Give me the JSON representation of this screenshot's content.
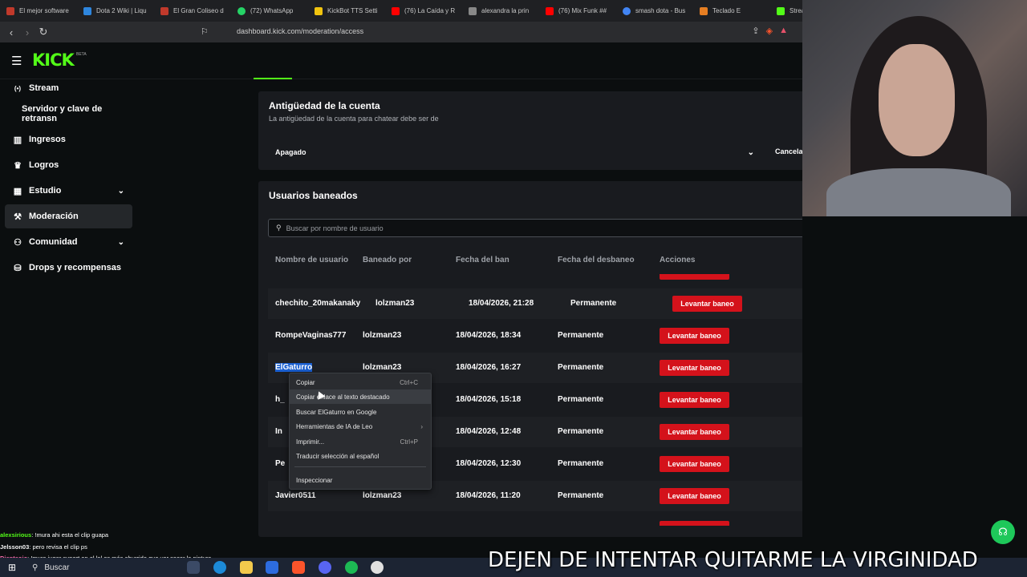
{
  "browser": {
    "tabs": [
      {
        "label": "El mejor software",
        "color": "#c0392b"
      },
      {
        "label": "Dota 2 Wiki | Liqu",
        "color": "#2e86de"
      },
      {
        "label": "El Gran Coliseo d",
        "color": "#c0392b"
      },
      {
        "label": "(72) WhatsApp",
        "color": "#25d366"
      },
      {
        "label": "KickBot TTS Setti",
        "color": "#f1c40f"
      },
      {
        "label": "(76) La Caída y R",
        "color": "#ff0000"
      },
      {
        "label": "alexandra la prin",
        "color": "#888888"
      },
      {
        "label": "(76) Mix Funk ##",
        "color": "#ff0000"
      },
      {
        "label": "smash dota - Bus",
        "color": "#4285f4"
      },
      {
        "label": "Teclado E",
        "color": "#e67e22"
      },
      {
        "label": "Stream",
        "color": "#53fc18"
      }
    ],
    "url": "dashboard.kick.com/moderation/access"
  },
  "header": {
    "logo": "KICK",
    "beta": "BETA"
  },
  "sidebar": {
    "items": [
      {
        "label": "Stream",
        "icon": "broadcast-icon",
        "glyph": "((•))"
      },
      {
        "label": "Servidor y clave de retransn",
        "icon": "",
        "glyph": ""
      },
      {
        "label": "Ingresos",
        "icon": "chart-icon",
        "glyph": "▥"
      },
      {
        "label": "Logros",
        "icon": "trophy-icon",
        "glyph": "🏆"
      },
      {
        "label": "Estudio",
        "icon": "grid-icon",
        "glyph": "▦"
      },
      {
        "label": "Moderación",
        "icon": "wrench-icon",
        "glyph": "🔧"
      },
      {
        "label": "Comunidad",
        "icon": "people-icon",
        "glyph": "👥"
      },
      {
        "label": "Drops y recompensas",
        "icon": "rewards-icon",
        "glyph": "⛁"
      }
    ]
  },
  "account_age": {
    "title": "Antigüedad de la cuenta",
    "subtitle": "La antigüedad de la cuenta para chatear debe ser de",
    "selected": "Apagado",
    "cancel": "Cancela"
  },
  "banned": {
    "title": "Usuarios baneados",
    "search_placeholder": "Buscar por nombre de usuario",
    "columns": [
      "Nombre de usuario",
      "Baneado por",
      "Fecha del ban",
      "Fecha del desbaneo",
      "Acciones"
    ],
    "action_label": "Levantar baneo",
    "rows": [
      {
        "user": "chechito_20makanaky",
        "by": "lolzman23",
        "date": "18/04/2026, 21:28",
        "unban": "Permanente"
      },
      {
        "user": "RompeVaginas777",
        "by": "lolzman23",
        "date": "18/04/2026, 18:34",
        "unban": "Permanente"
      },
      {
        "user": "ElGaturro",
        "by": "lolzman23",
        "date": "18/04/2026, 16:27",
        "unban": "Permanente"
      },
      {
        "user": "h_",
        "by": "",
        "date": "18/04/2026, 15:18",
        "unban": "Permanente"
      },
      {
        "user": "In",
        "by": "",
        "date": "18/04/2026, 12:48",
        "unban": "Permanente"
      },
      {
        "user": "Pe",
        "by": "",
        "date": "18/04/2026, 12:30",
        "unban": "Permanente"
      },
      {
        "user": "Javier0511",
        "by": "lolzman23",
        "date": "18/04/2026, 11:20",
        "unban": "Permanente"
      }
    ]
  },
  "context_menu": {
    "items": [
      {
        "label": "Copiar",
        "shortcut": "Ctrl+C"
      },
      {
        "label": "Copiar enlace al texto destacado",
        "shortcut": ""
      },
      {
        "label": "Buscar ElGaturro en Google",
        "shortcut": ""
      },
      {
        "label": "Herramientas de IA de Leo",
        "shortcut": "›"
      },
      {
        "label": "Imprimir...",
        "shortcut": "Ctrl+P"
      },
      {
        "label": "Traducir selección al español",
        "shortcut": ""
      },
      {
        "label": "Inspeccionar",
        "shortcut": ""
      }
    ]
  },
  "chat": [
    {
      "user": "alexsirious",
      "color": "#53fc18",
      "text": ": !mura ahi esta el clip guapa"
    },
    {
      "user": "Jelsson03",
      "color": "#f5f5f5",
      "text": ": pero revisa el clip ps"
    },
    {
      "user": "Dienteojo",
      "color": "#ff6fb1",
      "text": ": !mura jugar suport en el lol es más aburrido que ver secar la pintura"
    }
  ],
  "taskbar": {
    "search": "Buscar"
  },
  "overlay_banner": "DEJEN DE INTENTAR QUITARME LA VIRGINIDAD",
  "colors": {
    "accent": "#53fc18",
    "danger": "#d4121b",
    "background": "#0b0e0f",
    "card": "#191b1f"
  }
}
